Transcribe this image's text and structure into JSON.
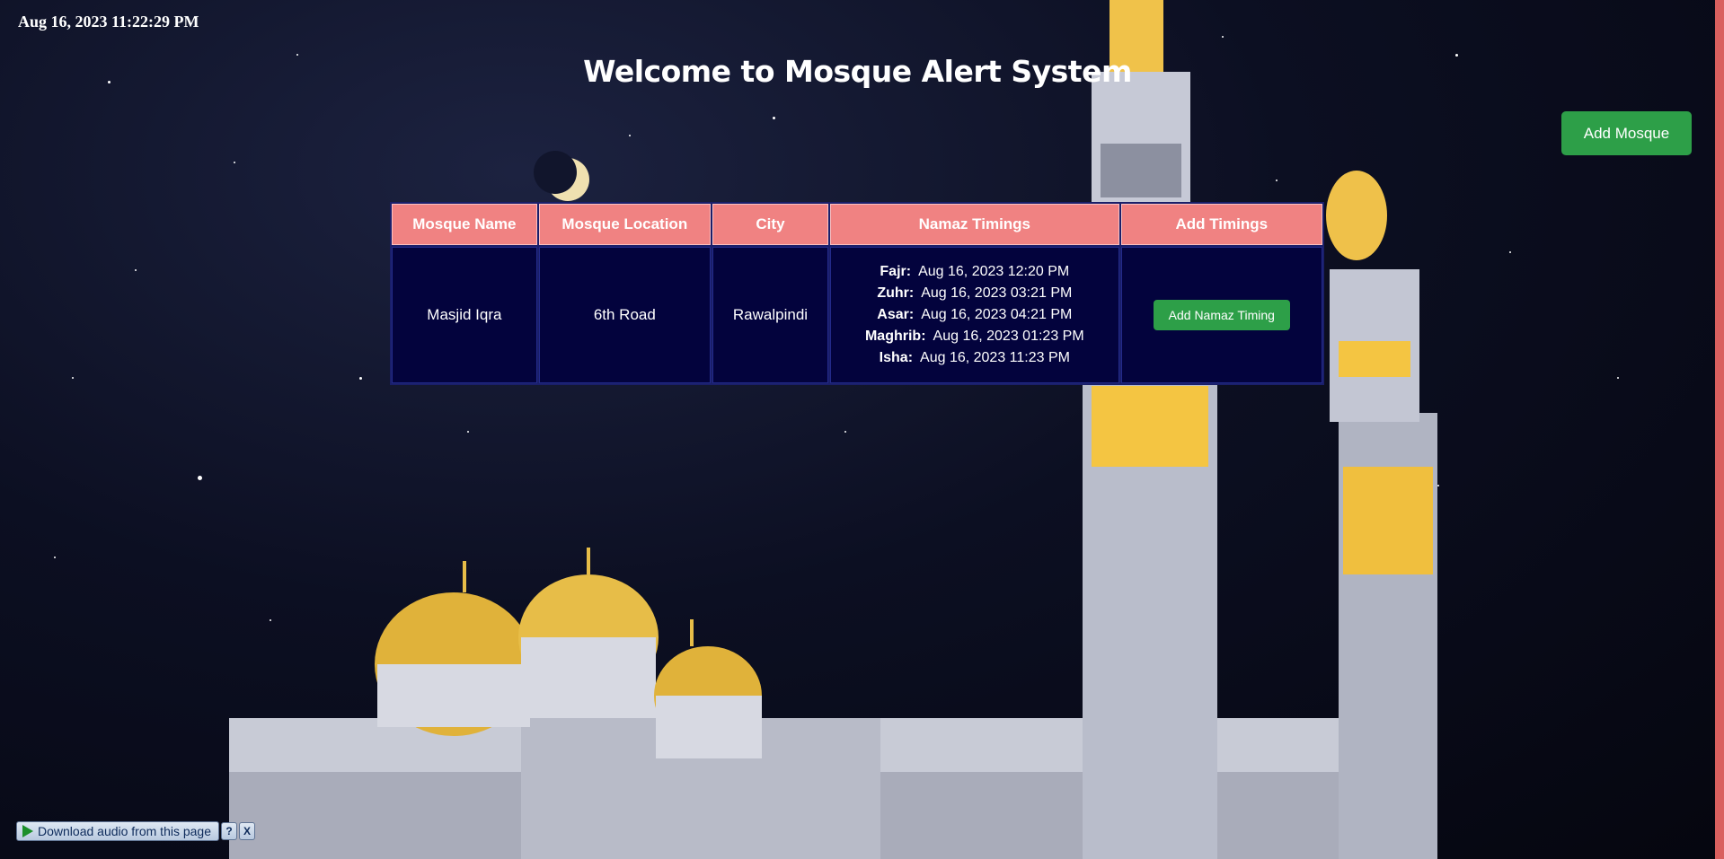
{
  "header": {
    "datetime": "Aug 16, 2023 11:22:29 PM",
    "title": "Welcome to Mosque Alert System",
    "add_mosque_label": "Add Mosque"
  },
  "table": {
    "columns": [
      "Mosque Name",
      "Mosque Location",
      "City",
      "Namaz Timings",
      "Add Timings"
    ],
    "rows": [
      {
        "name": "Masjid Iqra",
        "location": "6th Road",
        "city": "Rawalpindi",
        "timings": [
          {
            "label": "Fajr:",
            "value": "Aug 16, 2023 12:20 PM"
          },
          {
            "label": "Zuhr:",
            "value": "Aug 16, 2023 03:21 PM"
          },
          {
            "label": "Asar:",
            "value": "Aug 16, 2023 04:21 PM"
          },
          {
            "label": "Maghrib:",
            "value": "Aug 16, 2023 01:23 PM"
          },
          {
            "label": "Isha:",
            "value": "Aug 16, 2023 11:23 PM"
          }
        ],
        "action_label": "Add Namaz Timing"
      }
    ]
  },
  "download_bar": {
    "label": "Download audio from this page",
    "help_label": "?",
    "close_label": "X"
  },
  "colors": {
    "header_bg": "#f08282",
    "cell_bg": "#03033d",
    "button_green": "#2d9f48",
    "edge_strip": "#d9605f"
  },
  "icons": [
    "play-icon",
    "help-icon",
    "close-icon"
  ]
}
